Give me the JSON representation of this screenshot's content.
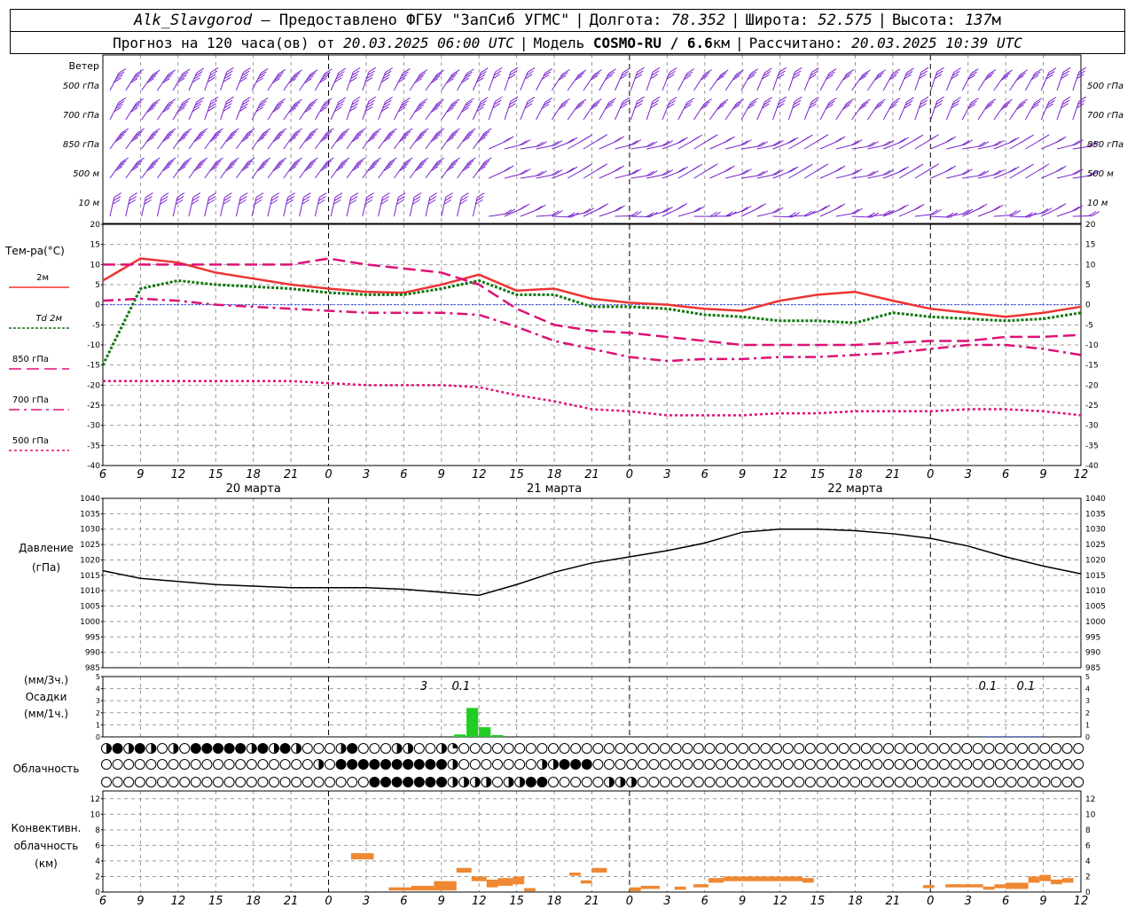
{
  "header": {
    "line1": {
      "station": "Alk_Slavgorod",
      "provider": "– Предоставлено ФГБУ \"ЗапСиб УГМС\"",
      "lon_label": "Долгота:",
      "lon_value": "78.352",
      "lat_label": "Широта:",
      "lat_value": "52.575",
      "alt_label": "Высота:",
      "alt_value": "137",
      "alt_unit": "м"
    },
    "line2": {
      "forecast_prefix": "Прогноз на 120 часа(ов) от",
      "forecast_start": "20.03.2025 06:00 UTC",
      "model_label": "Модель",
      "model_name": "COSMO-RU / 6.6",
      "model_unit": "км",
      "calc_label": "Рассчитано:",
      "calc_time": "20.03.2025 10:39 UTC"
    }
  },
  "time_axis": {
    "ticks": [
      "6",
      "9",
      "12",
      "15",
      "18",
      "21",
      "0",
      "3",
      "6",
      "9",
      "12",
      "15",
      "18",
      "21",
      "0",
      "3",
      "6",
      "9",
      "12",
      "15",
      "18",
      "21",
      "0",
      "3",
      "6",
      "9",
      "12"
    ],
    "dates": [
      "20 марта",
      "21 марта",
      "22 марта"
    ]
  },
  "wind": {
    "title": "Ветер",
    "levels": [
      "500 гПа",
      "700 гПа",
      "850 гПа",
      "500 м",
      "10 м"
    ]
  },
  "temperature": {
    "title": "Тем-ра(°C)",
    "legend": [
      {
        "label": "2м",
        "color": "#ee3333",
        "dash": ""
      },
      {
        "label": "Td 2м",
        "color": "#117711",
        "dash": "3,2"
      },
      {
        "label": "850 гПа",
        "color": "#dd1177",
        "dash": "14,6"
      },
      {
        "label": "700 гПа",
        "color": "#dd1177",
        "dash": "12,5,3,5"
      },
      {
        "label": "500 гПа",
        "color": "#dd1177",
        "dash": "3,3"
      }
    ],
    "yticks": [
      "20",
      "15",
      "10",
      "5",
      "0",
      "-5",
      "-10",
      "-15",
      "-20",
      "-25",
      "-30",
      "-35",
      "-40"
    ]
  },
  "pressure": {
    "title": "Давление",
    "unit": "(гПа)",
    "yticks": [
      "1040",
      "1035",
      "1030",
      "1025",
      "1020",
      "1015",
      "1010",
      "1005",
      "1000",
      "995",
      "990",
      "985"
    ]
  },
  "precip": {
    "title_unit3": "(мм/3ч.)",
    "title": "Осадки",
    "title_unit1": "(мм/1ч.)",
    "yticks": [
      "5",
      "4",
      "3",
      "2",
      "1",
      "0"
    ],
    "annotations": [
      "3",
      "0.1",
      "0.1",
      "0.1"
    ]
  },
  "cloud": {
    "title": "Облачность"
  },
  "convective": {
    "title1": "Конвективн.",
    "title2": "облачность",
    "title3": "(км)",
    "yticks": [
      "12",
      "10",
      "8",
      "6",
      "4",
      "2",
      "0"
    ]
  },
  "chart_data": [
    {
      "type": "line",
      "title": "Тем-ра(°C)",
      "ylim": [
        -40,
        20
      ],
      "x_hours": [
        0,
        3,
        6,
        9,
        12,
        15,
        18,
        21,
        24,
        27,
        30,
        33,
        36,
        39,
        42,
        45,
        48,
        51,
        54,
        57,
        60,
        63,
        66,
        69,
        72,
        75,
        78
      ],
      "series": [
        {
          "name": "2м",
          "values": [
            6,
            11.5,
            10.5,
            8,
            6.5,
            5,
            4,
            3.2,
            3,
            5,
            7.5,
            3.5,
            4,
            1.5,
            0.5,
            0,
            -1,
            -1.5,
            1,
            2.5,
            3.2,
            1,
            -1,
            -2,
            -3,
            -2,
            -0.5
          ]
        },
        {
          "name": "Td 2м",
          "values": [
            -15,
            4,
            6,
            5,
            4.5,
            4,
            3,
            2.5,
            2.5,
            4,
            6,
            2.5,
            2.5,
            -0.5,
            -0.5,
            -1,
            -2.5,
            -3,
            -4,
            -4,
            -4.5,
            -2,
            -3,
            -3.5,
            -4,
            -3.5,
            -2
          ]
        },
        {
          "name": "850 гПа",
          "values": [
            10,
            10,
            10,
            10,
            10,
            10,
            11.5,
            10,
            9,
            8,
            5,
            -1,
            -5,
            -6.5,
            -7,
            -8,
            -9,
            -10,
            -10,
            -10,
            -10,
            -9.5,
            -9,
            -9,
            -8,
            -8,
            -7.5
          ]
        },
        {
          "name": "700 гПа",
          "values": [
            1,
            1.5,
            1,
            0,
            -0.5,
            -1,
            -1.5,
            -2,
            -2,
            -2,
            -2.5,
            -5.5,
            -9,
            -11,
            -13,
            -14,
            -13.5,
            -13.5,
            -13,
            -13,
            -12.5,
            -12,
            -11,
            -10,
            -10,
            -11,
            -12.5
          ]
        },
        {
          "name": "500 гПа",
          "values": [
            -19,
            -19,
            -19,
            -19,
            -19,
            -19,
            -19.5,
            -20,
            -20,
            -20,
            -20.5,
            -22.5,
            -24,
            -26,
            -26.5,
            -27.5,
            -27.5,
            -27.5,
            -27,
            -27,
            -26.5,
            -26.5,
            -26.5,
            -26,
            -26,
            -26.5,
            -27.5
          ]
        }
      ]
    },
    {
      "type": "line",
      "title": "Давление",
      "ylim": [
        985,
        1040
      ],
      "x_hours": [
        0,
        3,
        6,
        9,
        12,
        15,
        18,
        21,
        24,
        27,
        30,
        33,
        36,
        39,
        42,
        45,
        48,
        51,
        54,
        57,
        60,
        63,
        66,
        69,
        72,
        75,
        78
      ],
      "series": [
        {
          "name": "Давление",
          "values": [
            1016.5,
            1014,
            1013,
            1012,
            1011.5,
            1011,
            1011,
            1011,
            1010.5,
            1009.5,
            1008.5,
            1012,
            1016,
            1019,
            1021,
            1023,
            1025.5,
            1029,
            1030,
            1030,
            1029.5,
            1028.5,
            1027,
            1024.5,
            1021,
            1018,
            1015.5
          ]
        }
      ]
    },
    {
      "type": "bar",
      "title": "Осадки",
      "ylim": [
        0,
        5
      ],
      "x_hours": [
        24.5,
        25.5,
        26.5,
        27.5,
        28.5,
        29.5,
        30.5,
        31.5,
        32.5,
        70.5,
        71.5,
        72.5,
        73.5,
        74.5,
        75.5
      ],
      "values": [
        0,
        0,
        0,
        0,
        0.2,
        2.4,
        0.8,
        0.15,
        0,
        0.05,
        0.05,
        0.05,
        0.05,
        0.05,
        0
      ]
    },
    {
      "type": "bar",
      "title": "Конвективн. облачность",
      "ylim": [
        0,
        13
      ],
      "segments": [
        {
          "x0": 19.8,
          "x1": 21.6,
          "bottom": 4.2,
          "top": 5.0
        },
        {
          "x0": 22.8,
          "x1": 24.6,
          "bottom": 0.2,
          "top": 0.6
        },
        {
          "x0": 24.6,
          "x1": 26.4,
          "bottom": 0.2,
          "top": 0.8
        },
        {
          "x0": 26.4,
          "x1": 28.2,
          "bottom": 0.2,
          "top": 1.4
        },
        {
          "x0": 28.2,
          "x1": 29.4,
          "bottom": 2.5,
          "top": 3.1
        },
        {
          "x0": 29.4,
          "x1": 30.6,
          "bottom": 1.4,
          "top": 2.0
        },
        {
          "x0": 30.6,
          "x1": 31.5,
          "bottom": 0.6,
          "top": 1.6
        },
        {
          "x0": 31.5,
          "x1": 32.7,
          "bottom": 0.8,
          "top": 1.8
        },
        {
          "x0": 32.7,
          "x1": 33.6,
          "bottom": 1.0,
          "top": 2.0
        },
        {
          "x0": 33.6,
          "x1": 34.5,
          "bottom": 0.1,
          "top": 0.5
        },
        {
          "x0": 37.2,
          "x1": 38.1,
          "bottom": 2.1,
          "top": 2.5
        },
        {
          "x0": 38.1,
          "x1": 39.0,
          "bottom": 1.1,
          "top": 1.5
        },
        {
          "x0": 39.0,
          "x1": 40.2,
          "bottom": 2.5,
          "top": 3.1
        },
        {
          "x0": 42.0,
          "x1": 42.9,
          "bottom": 0.1,
          "top": 0.6
        },
        {
          "x0": 42.9,
          "x1": 44.4,
          "bottom": 0.4,
          "top": 0.8
        },
        {
          "x0": 45.6,
          "x1": 46.5,
          "bottom": 0.3,
          "top": 0.7
        },
        {
          "x0": 47.1,
          "x1": 48.3,
          "bottom": 0.6,
          "top": 1.0
        },
        {
          "x0": 48.3,
          "x1": 49.5,
          "bottom": 1.2,
          "top": 1.8
        },
        {
          "x0": 49.5,
          "x1": 55.8,
          "bottom": 1.4,
          "top": 2.0
        },
        {
          "x0": 55.8,
          "x1": 56.7,
          "bottom": 1.2,
          "top": 1.8
        },
        {
          "x0": 65.4,
          "x1": 66.3,
          "bottom": 0.5,
          "top": 0.9
        },
        {
          "x0": 67.2,
          "x1": 70.2,
          "bottom": 0.6,
          "top": 1.0
        },
        {
          "x0": 70.2,
          "x1": 71.1,
          "bottom": 0.3,
          "top": 0.7
        },
        {
          "x0": 71.1,
          "x1": 72.0,
          "bottom": 0.5,
          "top": 1.0
        },
        {
          "x0": 72.0,
          "x1": 73.8,
          "bottom": 0.4,
          "top": 1.2
        },
        {
          "x0": 73.8,
          "x1": 74.7,
          "bottom": 1.2,
          "top": 2.0
        },
        {
          "x0": 74.7,
          "x1": 75.6,
          "bottom": 1.4,
          "top": 2.2
        },
        {
          "x0": 75.6,
          "x1": 76.5,
          "bottom": 1.0,
          "top": 1.6
        },
        {
          "x0": 76.5,
          "x1": 77.4,
          "bottom": 1.2,
          "top": 1.8
        }
      ]
    },
    {
      "type": "table",
      "title": "Облачность",
      "values_rows": [
        "1212101022222121210001200011001300000000000000000000000000000000000000000000000000000000",
        "0000000000000000000102222222222100000001122200000000000000000000000000000000000000000000",
        "0000000000000000000000002222222111101122000001110000000000000000000000000000000000000000"
      ]
    }
  ]
}
